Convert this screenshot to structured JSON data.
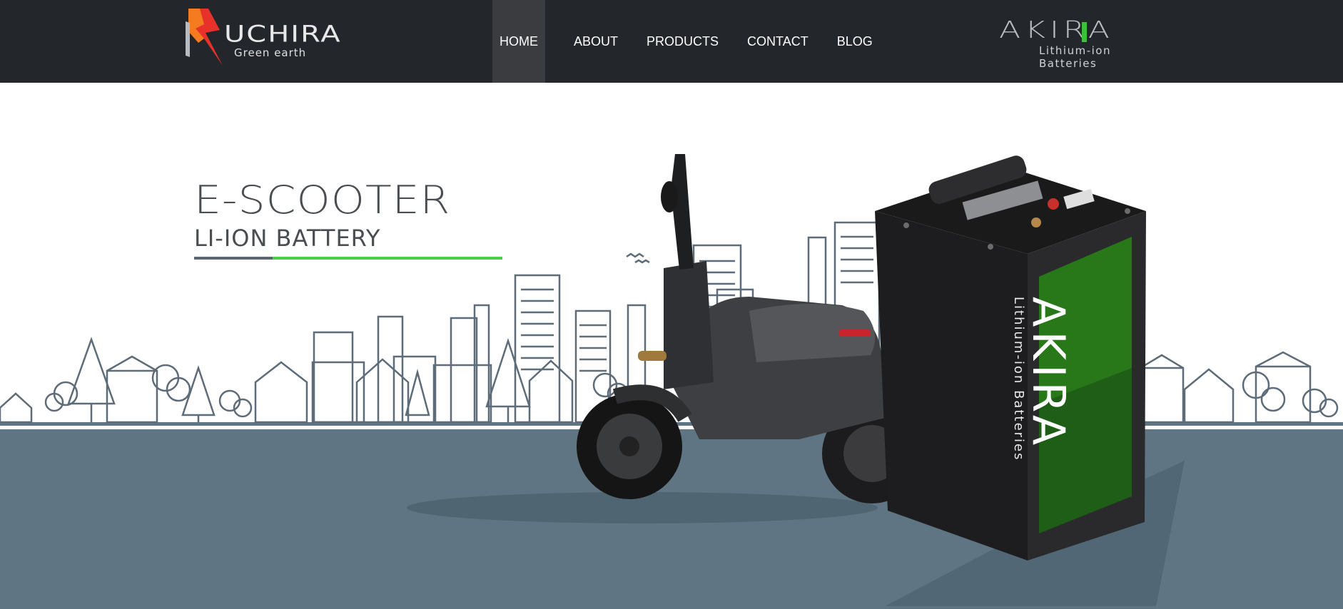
{
  "nav": {
    "brand_left": {
      "name": "UCHIRA",
      "tagline": "Green earth"
    },
    "items": [
      {
        "label": "HOME",
        "active": true
      },
      {
        "label": "ABOUT",
        "active": false
      },
      {
        "label": "PRODUCTS",
        "active": false
      },
      {
        "label": "CONTACT",
        "active": false
      },
      {
        "label": "BLOG",
        "active": false
      }
    ],
    "brand_right": {
      "name": "AKIRA",
      "tagline": "Lithium-ion Batteries"
    }
  },
  "hero": {
    "title": "E-SCOOTER",
    "subtitle": "LI-ION BATTERY",
    "battery_brand": "AKIRA",
    "battery_tagline": "Lithium-ion Batteries"
  },
  "colors": {
    "nav_bg": "#23262b",
    "nav_active_bg": "#3a3c40",
    "accent_green": "#46d146",
    "ground": "#5f7584",
    "logo_red": "#e8312a",
    "logo_orange": "#f47b20"
  }
}
